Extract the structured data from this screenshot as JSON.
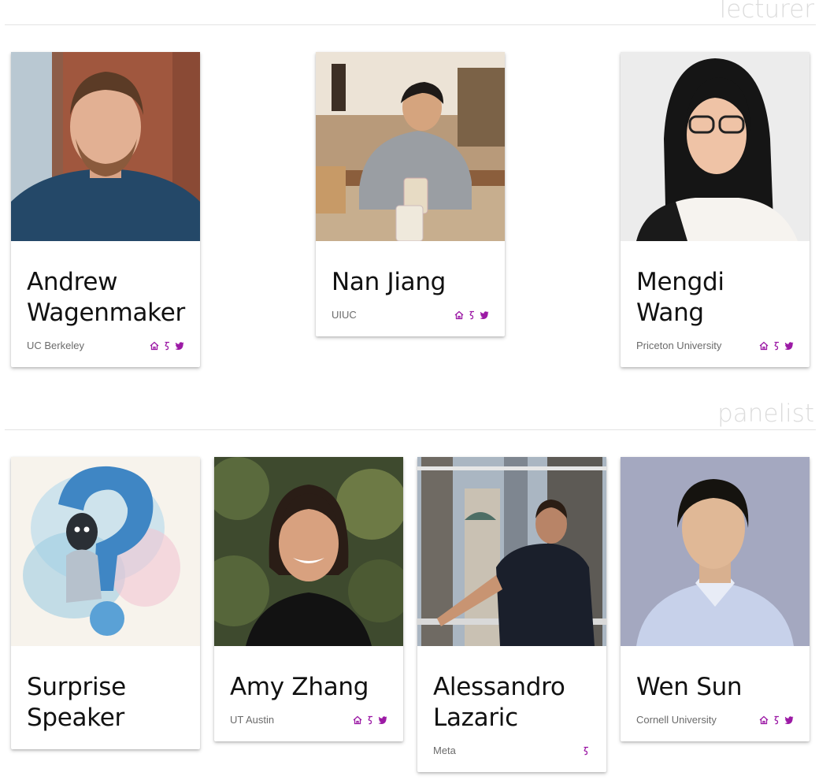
{
  "sections": {
    "lecturer": "lecturer",
    "panelist": "panelist"
  },
  "accent_color": "#9c1aa5",
  "lecturers": [
    {
      "name_line1": "Andrew",
      "name_line2": "Wagenmaker",
      "affiliation": "UC Berkeley",
      "icons": [
        "home-icon",
        "scholar-icon",
        "twitter-icon"
      ]
    },
    {
      "name_line1": "Nan Jiang",
      "name_line2": "",
      "affiliation": "UIUC",
      "icons": [
        "home-icon",
        "scholar-icon",
        "twitter-icon"
      ]
    },
    {
      "name_line1": "Mengdi Wang",
      "name_line2": "",
      "affiliation": "Priceton University",
      "icons": [
        "home-icon",
        "scholar-icon",
        "twitter-icon"
      ]
    }
  ],
  "panelists": [
    {
      "name_line1": "Surprise",
      "name_line2": "Speaker",
      "affiliation": "",
      "icons": []
    },
    {
      "name_line1": "Amy Zhang",
      "name_line2": "",
      "affiliation": "UT Austin",
      "icons": [
        "home-icon",
        "scholar-icon",
        "twitter-icon"
      ]
    },
    {
      "name_line1": "Alessandro",
      "name_line2": "Lazaric",
      "affiliation": "Meta",
      "icons": [
        "scholar-icon"
      ]
    },
    {
      "name_line1": "Wen Sun",
      "name_line2": "",
      "affiliation": "Cornell University",
      "icons": [
        "home-icon",
        "scholar-icon",
        "twitter-icon"
      ]
    }
  ]
}
